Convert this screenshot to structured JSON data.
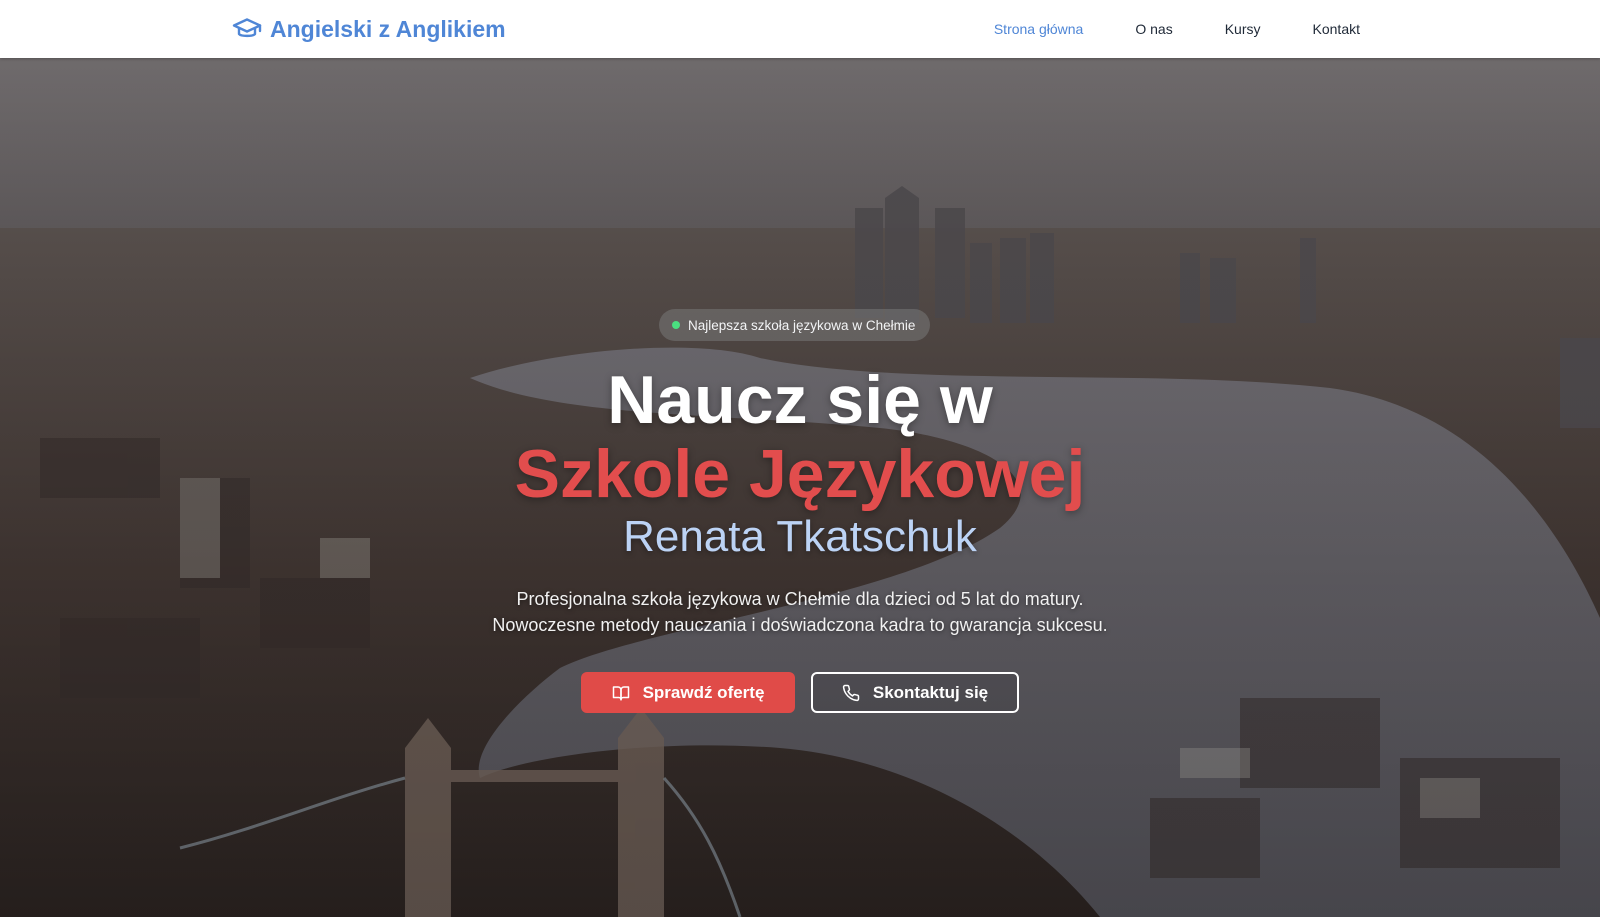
{
  "header": {
    "brand_icon": "graduation-cap-icon",
    "brand_name": "Angielski z Anglikiem",
    "nav": [
      {
        "label": "Strona główna",
        "active": true
      },
      {
        "label": "O nas",
        "active": false
      },
      {
        "label": "Kursy",
        "active": false
      },
      {
        "label": "Kontakt",
        "active": false
      }
    ]
  },
  "hero": {
    "badge": "Najlepsza szkoła językowa w Chełmie",
    "title_line1": "Naucz się w",
    "title_line2": "Szkole Językowej",
    "title_line3": "Renata Tkatschuk",
    "description_line1": "Profesjonalna szkoła językowa w Chełmie dla dzieci od 5 lat do matury.",
    "description_line2": "Nowoczesne metody nauczania i doświadczona kadra to gwarancja sukcesu.",
    "primary_button": {
      "label": "Sprawdź ofertę",
      "icon": "book-open-icon"
    },
    "secondary_button": {
      "label": "Skontaktuj się",
      "icon": "phone-icon"
    }
  },
  "colors": {
    "brand": "#4f86d6",
    "accent_red": "#e24d4d",
    "subtitle_blue": "#bcd3f5",
    "badge_dot": "#4ade80"
  }
}
